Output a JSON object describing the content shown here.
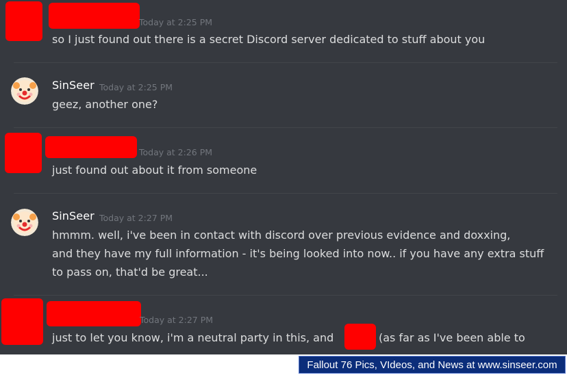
{
  "messages": [
    {
      "author": "",
      "timestamp": "Today at 2:25 PM",
      "lines": [
        "so I just found out there is a secret Discord server dedicated to stuff about you"
      ]
    },
    {
      "author": "SinSeer",
      "timestamp": "Today at 2:25 PM",
      "lines": [
        "geez, another one?"
      ]
    },
    {
      "author": "",
      "timestamp": "Today at 2:26 PM",
      "lines": [
        "just found out about it from someone"
      ]
    },
    {
      "author": "SinSeer",
      "timestamp": "Today at 2:27 PM",
      "lines": [
        "hmmm. well, i've been in contact with discord over previous evidence and doxxing,",
        "and they have my full information - it's being looked into now.. if you have any extra stuff",
        "to pass on, that'd be great..."
      ]
    },
    {
      "author": "",
      "timestamp": "Today at 2:27 PM",
      "lines": [
        "just to let you know, i'm a neutral party in this, and",
        "(as far as I've been able to"
      ]
    }
  ],
  "banner": {
    "text": "Fallout 76 Pics, VIdeos, and News at www.sinseer.com"
  },
  "colors": {
    "background": "#36393f",
    "redaction": "#ff0000",
    "banner_bg": "#0b2d7a"
  },
  "icons": {
    "sinseer_avatar": "clown-face-icon"
  }
}
